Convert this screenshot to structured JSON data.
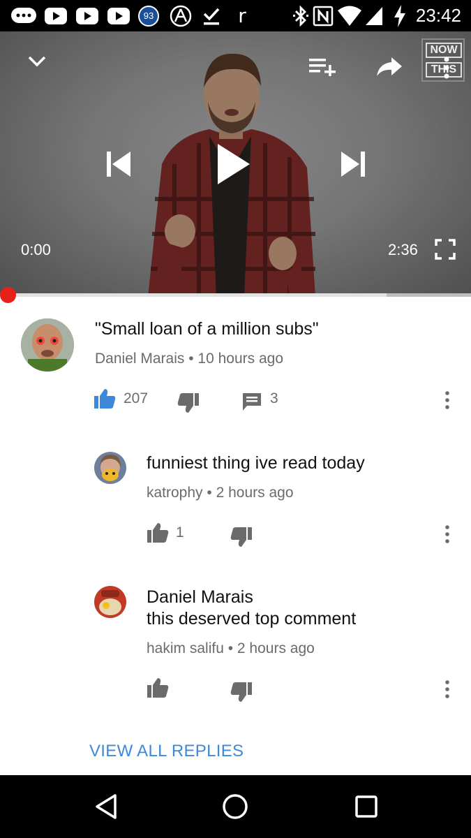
{
  "status_bar": {
    "time": "23:42",
    "notification_badge": "93",
    "icons": [
      "messaging-icon",
      "youtube-icon",
      "youtube-icon",
      "youtube-icon",
      "badge-93-icon",
      "arch-icon",
      "check-icon",
      "reddit-icon",
      "bluetooth-icon",
      "nfc-icon",
      "wifi-icon",
      "cell-signal-icon",
      "battery-charging-icon"
    ]
  },
  "player": {
    "current_time": "0:00",
    "duration": "2:36",
    "progress": 0.0,
    "buffered_fraction": 0.82,
    "channel_logo": {
      "line1": "NOW",
      "line2": "THIS"
    },
    "controls": [
      "chevron-down-icon",
      "add-to-playlist-icon",
      "share-icon",
      "more-vert-icon",
      "skip-previous-icon",
      "play-icon",
      "skip-next-icon",
      "fullscreen-icon"
    ]
  },
  "comments": {
    "top": {
      "text": "\"Small loan of a million subs\"",
      "author": "Daniel Marais",
      "time": "10 hours ago",
      "likes": "207",
      "replies": "3"
    },
    "replies": [
      {
        "text": "funniest thing ive read today",
        "author": "katrophy",
        "time": "2 hours ago",
        "likes": "1"
      },
      {
        "mention": "Daniel Marais",
        "text": "this deserved top comment",
        "author": "hakim salifu",
        "time": "2 hours ago",
        "likes": ""
      }
    ],
    "view_all": "VIEW ALL REPLIES"
  },
  "colors": {
    "accent_blue": "#3e88d9",
    "progress_red": "#e62117",
    "meta_gray": "#6b6b6b"
  }
}
